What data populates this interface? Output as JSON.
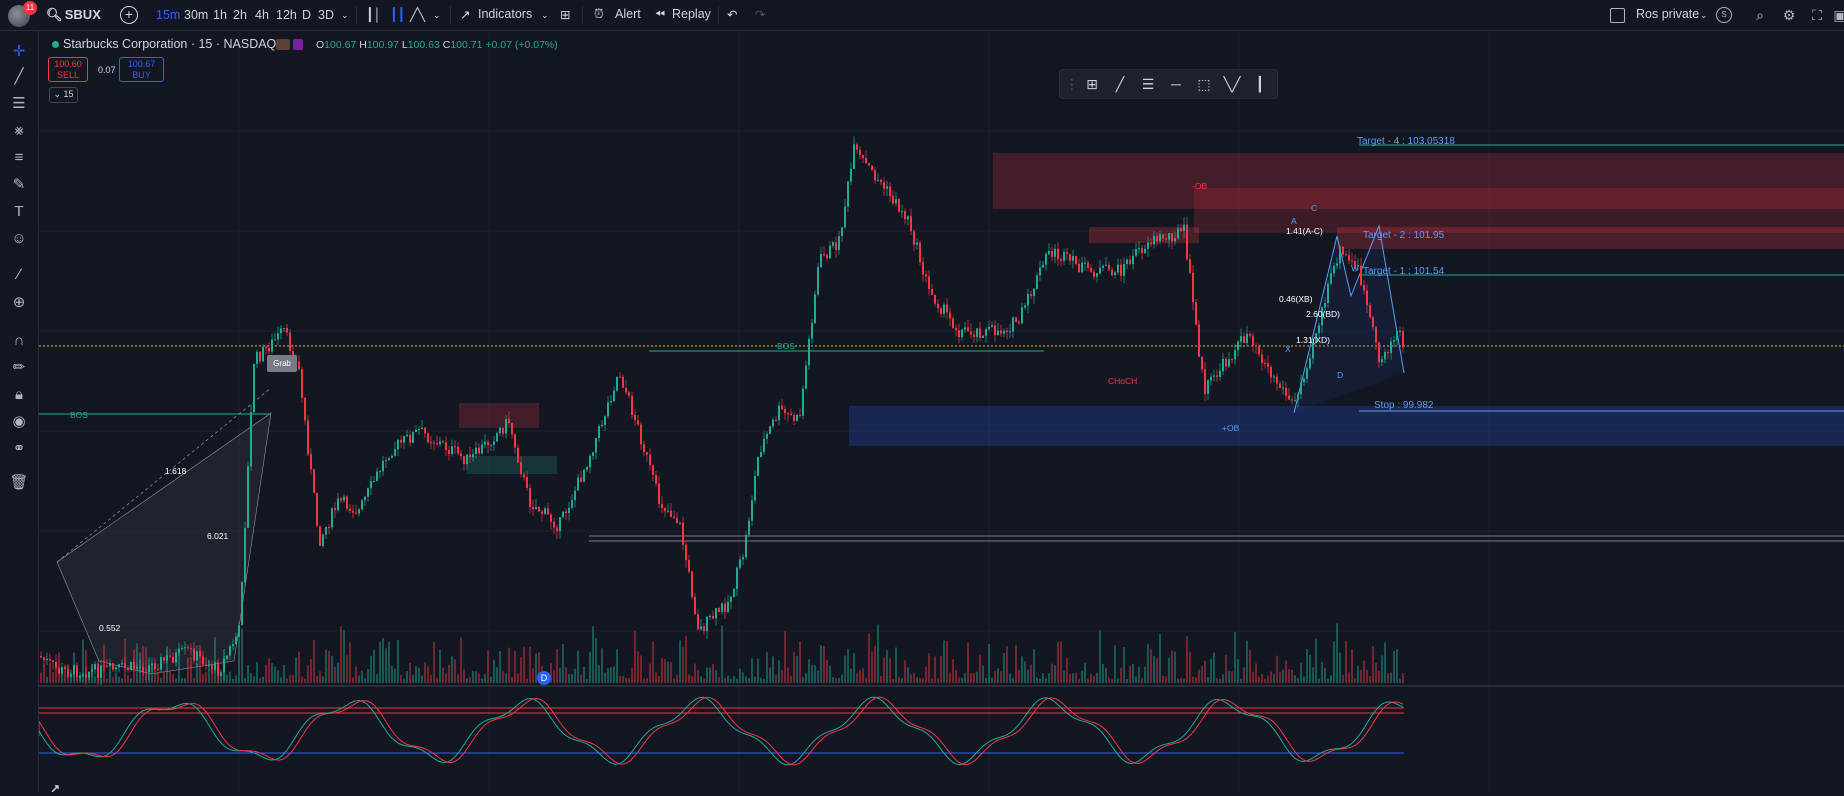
{
  "header": {
    "notification_count": "11",
    "symbol": "SBUX",
    "intervals": [
      "15m",
      "30m",
      "1h",
      "2h",
      "4h",
      "12h",
      "D",
      "3D"
    ],
    "active_interval": "15m",
    "indicators_label": "Indicators",
    "alert_label": "Alert",
    "replay_label": "Replay",
    "layout_name": "Ros private",
    "layout_badge": "S"
  },
  "legend": {
    "title": "Starbucks Corporation · 15 · NASDAQ",
    "o_key": "O",
    "o_val": "100.67",
    "h_key": "H",
    "h_val": "100.97",
    "l_key": "L",
    "l_val": "100.63",
    "c_key": "C",
    "c_val": "100.71 +0.07 (+0.07%)",
    "sell_price": "100.60",
    "sell_label": "SELL",
    "spread": "0.07",
    "buy_price": "100.67",
    "buy_label": "BUY",
    "collapse_label": "15"
  },
  "annotations": {
    "target4": "Target - 4 : 103.05318",
    "target2": "Target - 2 : 101.95",
    "target1": "Target - 1 : 101.54",
    "stop": "Stop : 99.982",
    "fib1": "1.618",
    "fib2": "6.021",
    "fib3": "0.552",
    "choch": "CHoCH",
    "bos_left": "BOS",
    "bos_mid": "BOS",
    "ob_top": "-OB",
    "ob_bottom": "+OB",
    "grab": "Grab",
    "pattern_a": "A",
    "pattern_c": "C",
    "pattern_d": "D",
    "pattern_x": "X",
    "ratio_ac": "1.41(A-C)",
    "ratio_xb": "0.46(XB)",
    "ratio_bd": "2.60(BD)",
    "ratio_xd": "1.31(XD)",
    "w_mark": "W",
    "dividend_mark": "D"
  },
  "colors": {
    "bg": "#131722",
    "up": "#22ab94",
    "down": "#f23645",
    "accent": "#2962ff",
    "target": "#5b9cf6"
  }
}
